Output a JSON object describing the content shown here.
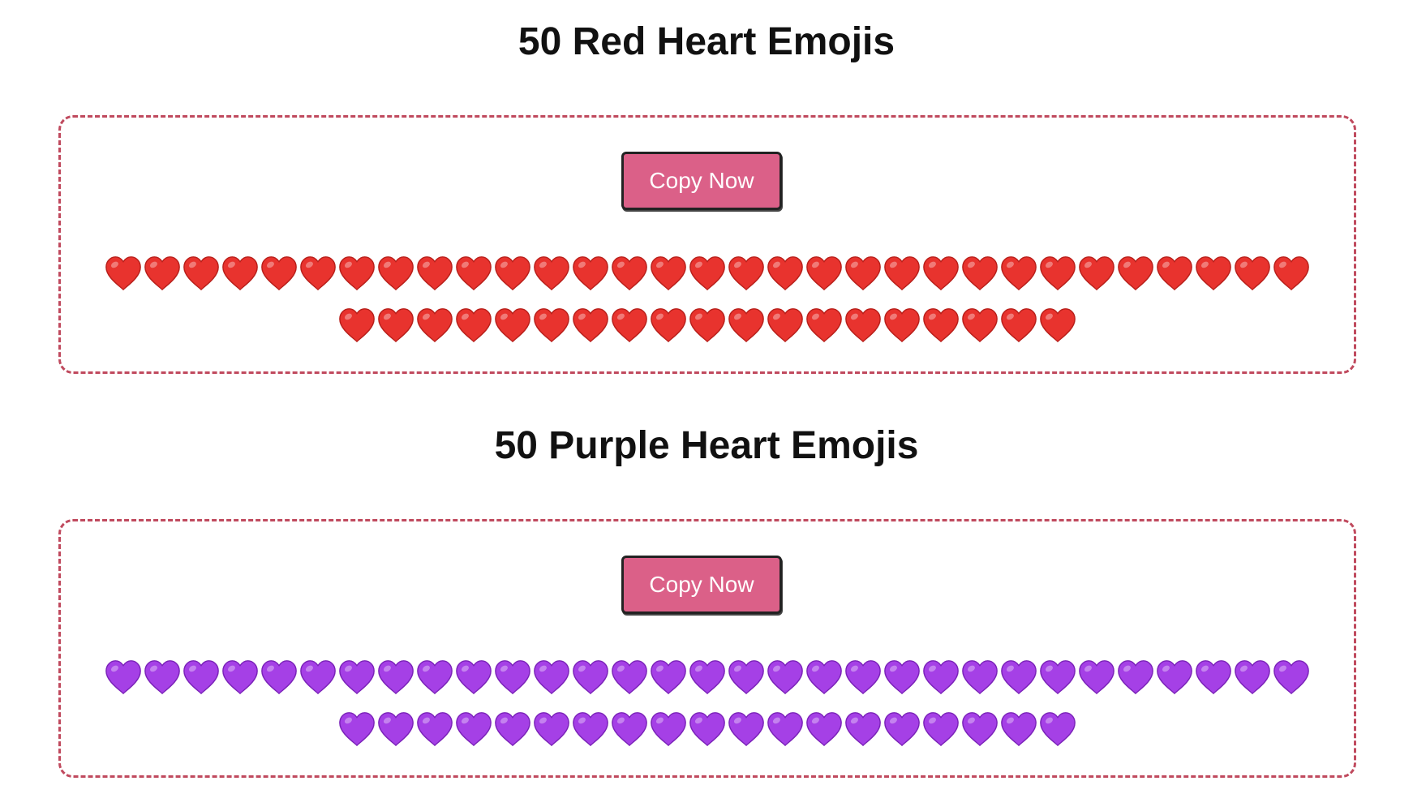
{
  "sections": [
    {
      "title": "50 Red Heart Emojis",
      "button_label": "Copy Now",
      "heart_count": 50,
      "row_counts": [
        31,
        19
      ],
      "heart_color": "#e8332e",
      "heart_shade": "#b81f1a",
      "icon": "red-heart-icon"
    },
    {
      "title": "50 Purple Heart Emojis",
      "button_label": "Copy Now",
      "heart_count": 50,
      "row_counts": [
        31,
        19
      ],
      "heart_color": "#a540e6",
      "heart_shade": "#7a22b8",
      "icon": "purple-heart-icon"
    }
  ],
  "colors": {
    "accent": "#db6088",
    "border": "#c04a5e",
    "button_text": "#ffffff"
  }
}
